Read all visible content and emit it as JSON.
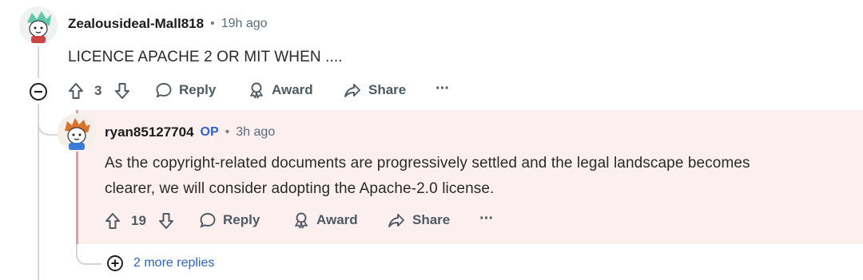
{
  "comment": {
    "username": "Zealousideal-Mall818",
    "separator": "•",
    "time": "19h ago",
    "body": "LICENCE APACHE 2 OR MIT WHEN ....",
    "votes": "3",
    "actions": {
      "reply": "Reply",
      "award": "Award",
      "share": "Share",
      "more": "···"
    }
  },
  "reply": {
    "username": "ryan85127704",
    "op_badge": "OP",
    "separator": "•",
    "time": "3h ago",
    "body_line1": "As the copyright-related documents are progressively settled and the legal landscape becomes",
    "body_line2": "clearer, we will consider adopting the Apache-2.0 license.",
    "votes": "19",
    "actions": {
      "reply": "Reply",
      "award": "Award",
      "share": "Share",
      "more": "···"
    }
  },
  "more_replies_label": "2 more replies",
  "colors": {
    "highlight_bg": "#fbeff0",
    "highlight_border": "#e79a9f",
    "link_blue": "#2e62c6"
  },
  "icons": [
    "collapse-icon",
    "upvote-icon",
    "downvote-icon",
    "reply-icon",
    "award-icon",
    "share-icon",
    "more-icon",
    "expand-icon"
  ]
}
